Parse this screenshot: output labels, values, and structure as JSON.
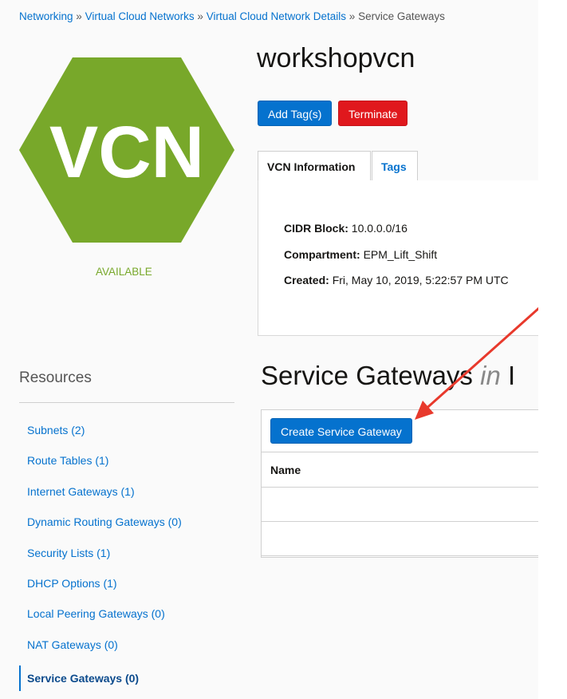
{
  "breadcrumb": {
    "items": [
      "Networking",
      "Virtual Cloud Networks",
      "Virtual Cloud Network Details"
    ],
    "separator": "»",
    "current": "Service Gateways"
  },
  "vcn": {
    "logo_text": "VCN",
    "status": "AVAILABLE",
    "title": "workshopvcn",
    "hex_color": "#78a82a"
  },
  "actions": {
    "add_tags": "Add Tag(s)",
    "terminate": "Terminate"
  },
  "tabs": {
    "info": "VCN Information",
    "tags": "Tags"
  },
  "info": {
    "cidr_label": "CIDR Block:",
    "cidr_value": "10.0.0.0/16",
    "compartment_label": "Compartment:",
    "compartment_value": "EPM_Lift_Shift",
    "created_label": "Created:",
    "created_value": "Fri, May 10, 2019, 5:22:57 PM UTC"
  },
  "resources": {
    "heading": "Resources",
    "items": [
      "Subnets (2)",
      "Route Tables (1)",
      "Internet Gateways (1)",
      "Dynamic Routing Gateways (0)",
      "Security Lists (1)",
      "DHCP Options (1)",
      "Local Peering Gateways (0)",
      "NAT Gateways (0)",
      "Service Gateways (0)"
    ]
  },
  "section": {
    "title_main": "Service Gateways",
    "title_in": "in",
    "title_tail": "I"
  },
  "table": {
    "create_button": "Create Service Gateway",
    "column_name": "Name"
  },
  "colors": {
    "accent": "#0572ce",
    "danger": "#e0181d",
    "annotation": "#e8392c"
  }
}
